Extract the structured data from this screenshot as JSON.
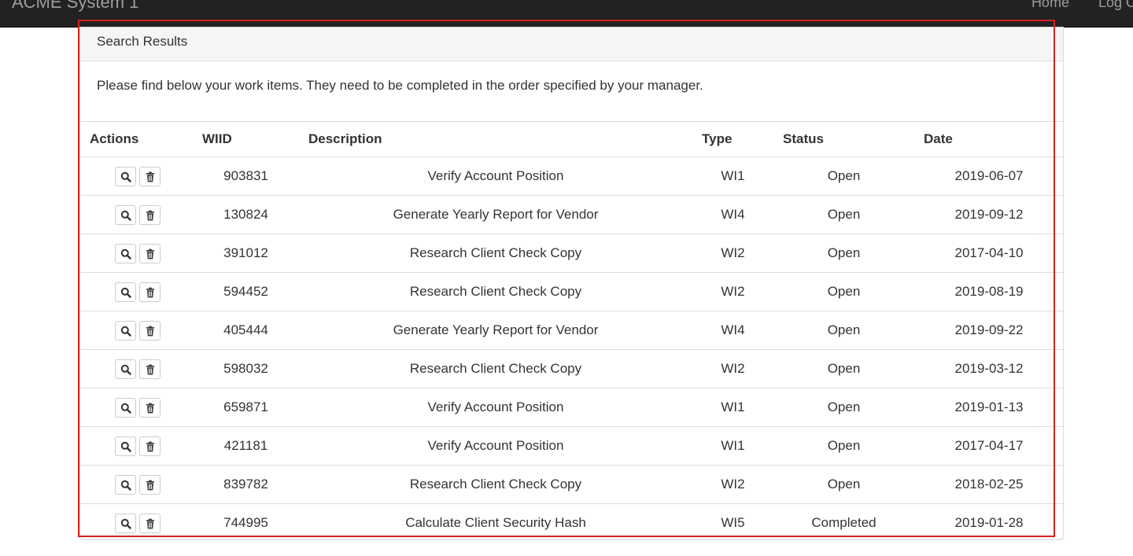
{
  "navbar": {
    "brand": "ACME System 1",
    "links": [
      "Home",
      "Log Out"
    ]
  },
  "panel": {
    "heading": "Search Results",
    "message": "Please find below your work items. They need to be completed in the order specified by your manager."
  },
  "table": {
    "headers": [
      "Actions",
      "WIID",
      "Description",
      "Type",
      "Status",
      "Date"
    ],
    "rows": [
      {
        "wiid": "903831",
        "description": "Verify Account Position",
        "type": "WI1",
        "status": "Open",
        "date": "2019-06-07"
      },
      {
        "wiid": "130824",
        "description": "Generate Yearly Report for Vendor",
        "type": "WI4",
        "status": "Open",
        "date": "2019-09-12"
      },
      {
        "wiid": "391012",
        "description": "Research Client Check Copy",
        "type": "WI2",
        "status": "Open",
        "date": "2017-04-10"
      },
      {
        "wiid": "594452",
        "description": "Research Client Check Copy",
        "type": "WI2",
        "status": "Open",
        "date": "2019-08-19"
      },
      {
        "wiid": "405444",
        "description": "Generate Yearly Report for Vendor",
        "type": "WI4",
        "status": "Open",
        "date": "2019-09-22"
      },
      {
        "wiid": "598032",
        "description": "Research Client Check Copy",
        "type": "WI2",
        "status": "Open",
        "date": "2019-03-12"
      },
      {
        "wiid": "659871",
        "description": "Verify Account Position",
        "type": "WI1",
        "status": "Open",
        "date": "2019-01-13"
      },
      {
        "wiid": "421181",
        "description": "Verify Account Position",
        "type": "WI1",
        "status": "Open",
        "date": "2017-04-17"
      },
      {
        "wiid": "839782",
        "description": "Research Client Check Copy",
        "type": "WI2",
        "status": "Open",
        "date": "2018-02-25"
      },
      {
        "wiid": "744995",
        "description": "Calculate Client Security Hash",
        "type": "WI5",
        "status": "Completed",
        "date": "2019-01-28"
      }
    ],
    "action_icons": [
      "search-icon",
      "trash-icon"
    ]
  },
  "colors": {
    "navbar_bg": "#222222",
    "navbar_text": "#9d9d9d",
    "highlight_border": "#d42020",
    "panel_heading_bg": "#f5f5f5"
  }
}
